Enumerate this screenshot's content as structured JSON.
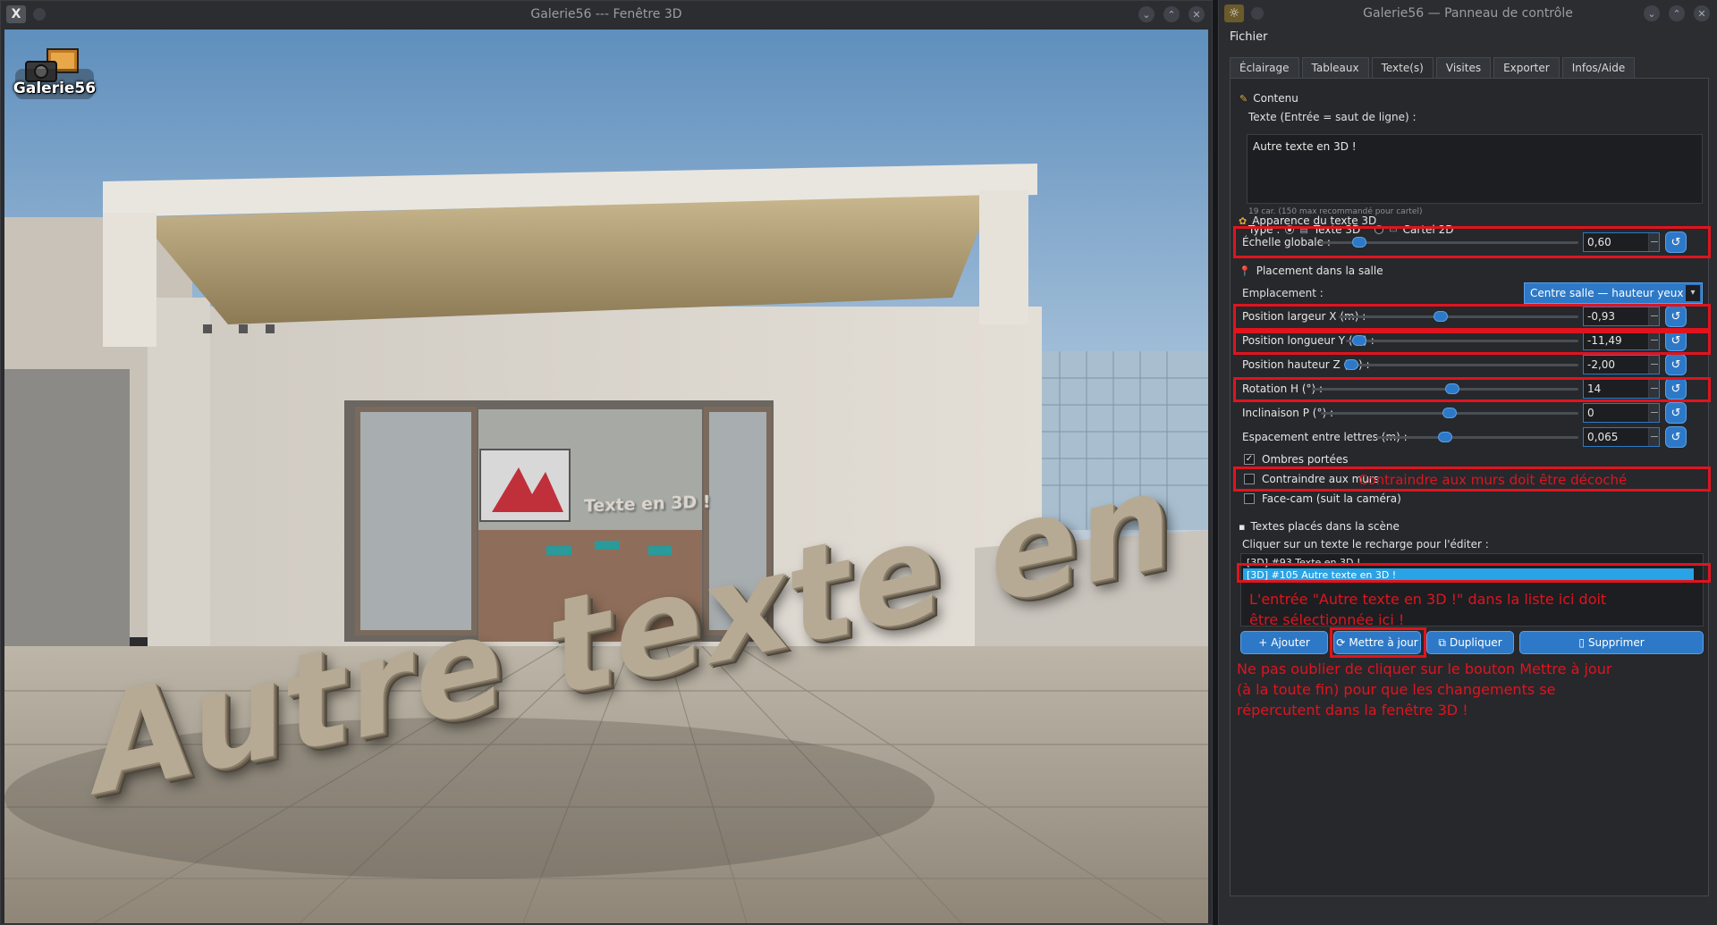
{
  "window3d": {
    "title": "Galerie56 --- Fenêtre 3D",
    "logo_text": "Galerie56",
    "scene_text_big": "Autre texte en 3D !",
    "scene_text_small": "Texte en 3D !"
  },
  "panel": {
    "title": "Galerie56 — Panneau de contrôle",
    "menu": [
      "Fichier"
    ],
    "tabs": [
      "Éclairage",
      "Tableaux",
      "Texte(s)",
      "Visites",
      "Exporter",
      "Infos/Aide"
    ],
    "active_tab": "Texte(s)",
    "contenu": {
      "section": "Contenu",
      "texte_label": "Texte (Entrée = saut de ligne) :",
      "texte_value": "Autre texte en 3D !",
      "hint": "19 car. (150 max recommandé pour cartel)",
      "type_label": "Type :",
      "type_options": [
        "Texte 3D",
        "Cartel 2D"
      ],
      "type_selected": "Texte 3D"
    },
    "apparence": {
      "section": "Apparence du texte 3D",
      "echelle_label": "Échelle globale :",
      "echelle_value": "0,60"
    },
    "placement": {
      "section": "Placement dans la salle",
      "emplacement_label": "Emplacement :",
      "emplacement_value": "Centre salle — hauteur yeux",
      "rows": [
        {
          "label": "Position largeur X (m) :",
          "value": "-0,93",
          "level": 0.42
        },
        {
          "label": "Position longueur Y (m) :",
          "value": "-11,49",
          "level": 0.03
        },
        {
          "label": "Position hauteur Z (m) :",
          "value": "-2,00",
          "level": 0.0
        },
        {
          "label": "Rotation H (°) :",
          "value": "14",
          "level": 0.53
        },
        {
          "label": "Inclinaison P (°) :",
          "value": "0",
          "level": 0.5
        },
        {
          "label": "Espacement entre lettres (m) :",
          "value": "0,065",
          "level": 0.33
        }
      ],
      "echelle_level": 0.13,
      "ombres_label": "Ombres portées",
      "ombres_checked": true,
      "contraindre_label": "Contraindre aux murs",
      "contraindre_checked": false,
      "facecam_label": "Face-cam (suit la caméra)",
      "facecam_checked": false
    },
    "textes_places": {
      "section": "Textes placés dans la scène",
      "instruction": "Cliquer sur un texte le recharge pour l'éditer :",
      "items": [
        "[3D] #93  Texte en 3D !",
        "[3D] #105  Autre texte en 3D !"
      ],
      "selected_index": 1
    },
    "buttons": {
      "ajouter": "Ajouter",
      "mettre_a_jour": "Mettre à jour",
      "dupliquer": "Dupliquer",
      "supprimer": "Supprimer"
    },
    "annotations": {
      "contraindre_note": "Contraindre aux murs doit être décoché",
      "list_note_1": "L'entrée \"Autre texte en 3D !\" dans la liste ici doit",
      "list_note_2": "être sélectionnée ici !",
      "update_note_1": "Ne pas oublier de cliquer sur le bouton Mettre à jour",
      "update_note_2": "(à la toute fin) pour que les changements se",
      "update_note_3": "répercutent dans la fenêtre 3D !"
    },
    "accent_color": "#2d79c7",
    "annotation_color": "#e0141e"
  }
}
